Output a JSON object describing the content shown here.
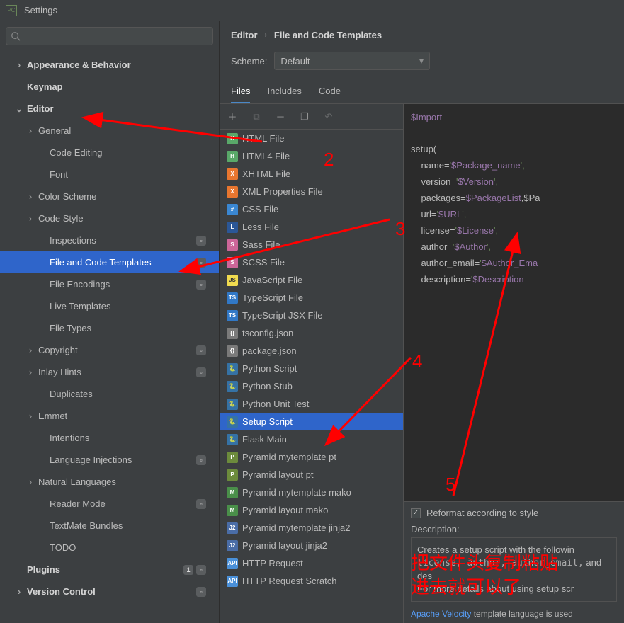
{
  "window_title": "Settings",
  "breadcrumb": [
    "Editor",
    "File and Code Templates"
  ],
  "scheme_label": "Scheme:",
  "scheme_value": "Default",
  "tabs": [
    "Files",
    "Includes",
    "Code"
  ],
  "active_tab": 0,
  "sidebar": [
    {
      "label": "Appearance & Behavior",
      "level": 0,
      "bold": true,
      "chevron": ">"
    },
    {
      "label": "Keymap",
      "level": 0,
      "bold": true
    },
    {
      "label": "Editor",
      "level": 0,
      "bold": true,
      "chevron": "v"
    },
    {
      "label": "General",
      "level": 1,
      "chevron": ">"
    },
    {
      "label": "Code Editing",
      "level": 2
    },
    {
      "label": "Font",
      "level": 2
    },
    {
      "label": "Color Scheme",
      "level": 1,
      "chevron": ">"
    },
    {
      "label": "Code Style",
      "level": 1,
      "chevron": ">"
    },
    {
      "label": "Inspections",
      "level": 2,
      "badge": "sq"
    },
    {
      "label": "File and Code Templates",
      "level": 2,
      "selected": true,
      "badge": "sq"
    },
    {
      "label": "File Encodings",
      "level": 2,
      "badge": "sq"
    },
    {
      "label": "Live Templates",
      "level": 2
    },
    {
      "label": "File Types",
      "level": 2
    },
    {
      "label": "Copyright",
      "level": 1,
      "chevron": ">",
      "badge": "sq"
    },
    {
      "label": "Inlay Hints",
      "level": 1,
      "chevron": ">",
      "badge": "sq"
    },
    {
      "label": "Duplicates",
      "level": 2
    },
    {
      "label": "Emmet",
      "level": 1,
      "chevron": ">"
    },
    {
      "label": "Intentions",
      "level": 2
    },
    {
      "label": "Language Injections",
      "level": 2,
      "badge": "sq"
    },
    {
      "label": "Natural Languages",
      "level": 1,
      "chevron": ">"
    },
    {
      "label": "Reader Mode",
      "level": 2,
      "badge": "sq"
    },
    {
      "label": "TextMate Bundles",
      "level": 2
    },
    {
      "label": "TODO",
      "level": 2
    },
    {
      "label": "Plugins",
      "level": 0,
      "bold": true,
      "badge": "count",
      "count": "1"
    },
    {
      "label": "Version Control",
      "level": 0,
      "bold": true,
      "chevron": ">",
      "badge": "sq"
    }
  ],
  "templates": [
    {
      "label": "HTML File",
      "color": "#59a869",
      "tag": "H"
    },
    {
      "label": "HTML4 File",
      "color": "#59a869",
      "tag": "H"
    },
    {
      "label": "XHTML File",
      "color": "#e8762f",
      "tag": "X"
    },
    {
      "label": "XML Properties File",
      "color": "#e8762f",
      "tag": "X"
    },
    {
      "label": "CSS File",
      "color": "#3a87d2",
      "tag": "#"
    },
    {
      "label": "Less File",
      "color": "#2b5797",
      "tag": "L"
    },
    {
      "label": "Sass File",
      "color": "#cc6699",
      "tag": "S"
    },
    {
      "label": "SCSS File",
      "color": "#cc6699",
      "tag": "S"
    },
    {
      "label": "JavaScript File",
      "color": "#f0db4f",
      "tag": "JS",
      "fg": "#333"
    },
    {
      "label": "TypeScript File",
      "color": "#3178c6",
      "tag": "TS"
    },
    {
      "label": "TypeScript JSX File",
      "color": "#3178c6",
      "tag": "TS"
    },
    {
      "label": "tsconfig.json",
      "color": "#7a7a7a",
      "tag": "{}"
    },
    {
      "label": "package.json",
      "color": "#7a7a7a",
      "tag": "{}"
    },
    {
      "label": "Python Script",
      "color": "#3572A5",
      "tag": "🐍"
    },
    {
      "label": "Python Stub",
      "color": "#3572A5",
      "tag": "🐍"
    },
    {
      "label": "Python Unit Test",
      "color": "#3572A5",
      "tag": "🐍"
    },
    {
      "label": "Setup Script",
      "color": "#3572A5",
      "tag": "🐍",
      "selected": true
    },
    {
      "label": "Flask Main",
      "color": "#3572A5",
      "tag": "🐍"
    },
    {
      "label": "Pyramid mytemplate pt",
      "color": "#6c8b3c",
      "tag": "P"
    },
    {
      "label": "Pyramid layout pt",
      "color": "#6c8b3c",
      "tag": "P"
    },
    {
      "label": "Pyramid mytemplate mako",
      "color": "#4a8f4a",
      "tag": "M"
    },
    {
      "label": "Pyramid layout mako",
      "color": "#4a8f4a",
      "tag": "M"
    },
    {
      "label": "Pyramid mytemplate jinja2",
      "color": "#4a6da7",
      "tag": "J2"
    },
    {
      "label": "Pyramid layout jinja2",
      "color": "#4a6da7",
      "tag": "J2"
    },
    {
      "label": "HTTP Request",
      "color": "#4a90d9",
      "tag": "API"
    },
    {
      "label": "HTTP Request Scratch",
      "color": "#4a90d9",
      "tag": "API"
    }
  ],
  "code": {
    "l1": "$Import",
    "l2": "setup(",
    "l3a": "    name=",
    "l3b": "'",
    "l3c": "$Package_name",
    "l3d": "',",
    "l4a": "    version=",
    "l4b": "'",
    "l4c": "$Version",
    "l4d": "',",
    "l5a": "    packages=",
    "l5b": "$PackageList",
    "l5c": ",$Pa",
    "l6a": "    url=",
    "l6b": "'",
    "l6c": "$URL",
    "l6d": "',",
    "l7a": "    license=",
    "l7b": "'",
    "l7c": "$License",
    "l7d": "',",
    "l8a": "    author=",
    "l8b": "'",
    "l8c": "$Author",
    "l8d": "',",
    "l9a": "    author_email=",
    "l9b": "'",
    "l9c": "$Author_Ema",
    "l9d": "",
    "l10a": "    description=",
    "l10b": "'",
    "l10c": "$Description",
    "l10d": ""
  },
  "reformat_label": "Reformat according to style",
  "desc_label": "Description:",
  "desc_line1": "Creates a setup script with the followin",
  "desc_code": "license, author, author_email,",
  "desc_line1b": " and des",
  "desc_line2": "For more details about using setup scr",
  "hint_link": "Apache Velocity",
  "hint_text": " template language is used",
  "annotations": {
    "n2": "2",
    "n3": "3",
    "n4": "4",
    "n5": "5",
    "cn": "把文件头复制粘贴\n进去就可以了"
  }
}
